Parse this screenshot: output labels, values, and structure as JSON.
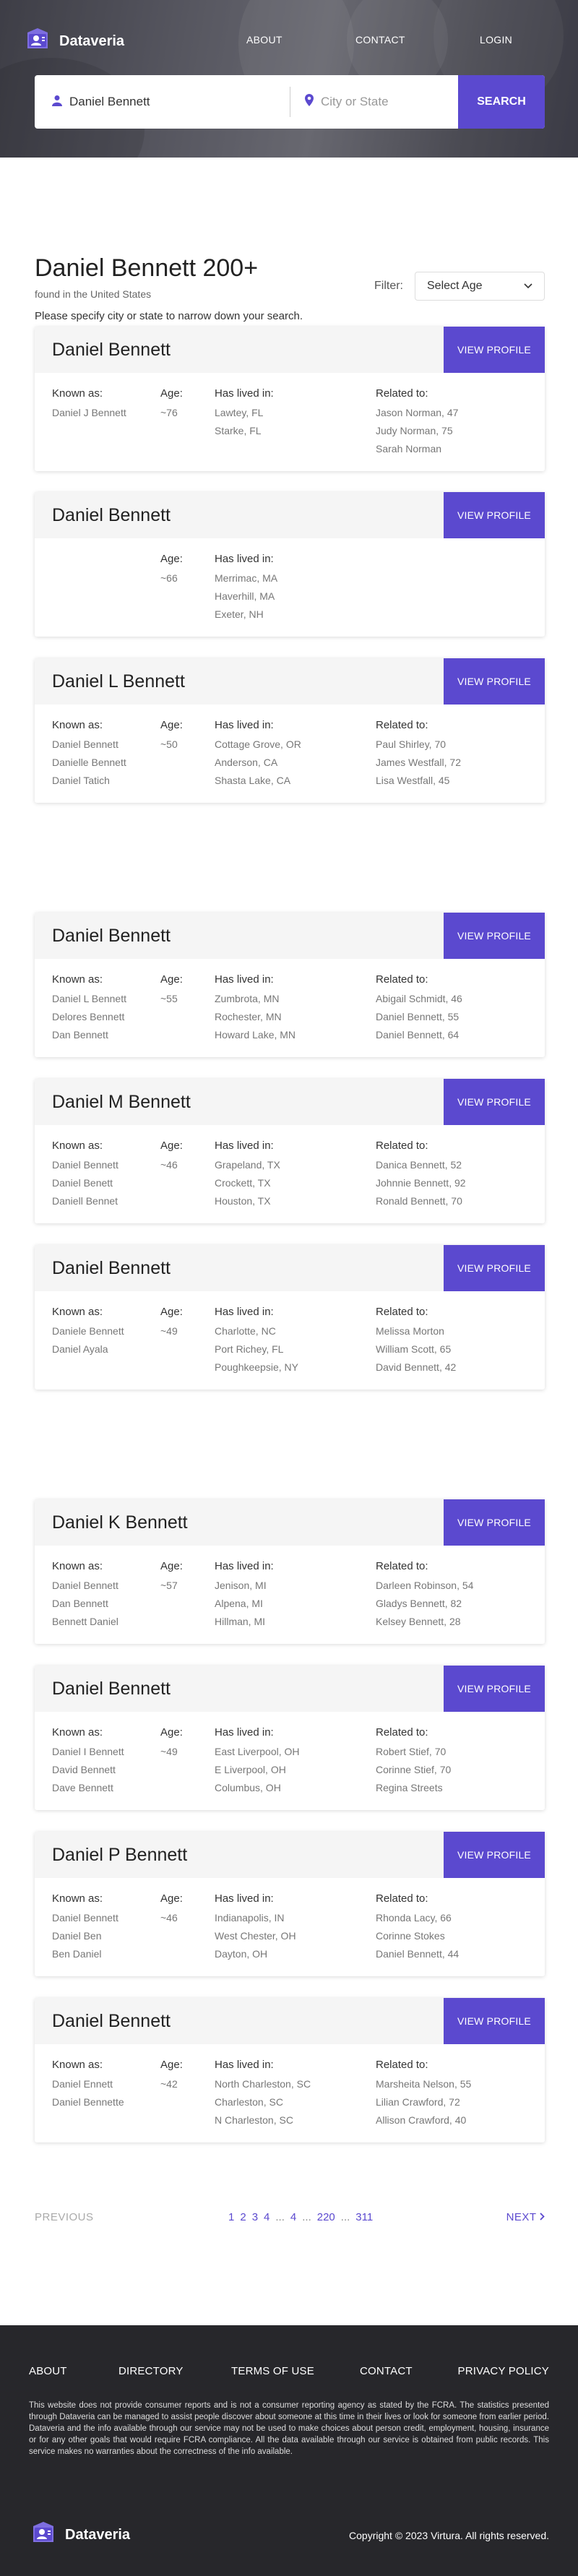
{
  "brand": {
    "name": "Dataveria",
    "accent": "#5b49cf",
    "logo_icon": "person-id-icon"
  },
  "nav": {
    "about": "ABOUT",
    "contact": "CONTACT",
    "login": "LOGIN"
  },
  "search": {
    "name_value": "Daniel Bennett",
    "location_placeholder": "City or State",
    "button_label": "SEARCH"
  },
  "results": {
    "title": "Daniel Bennett 200+",
    "subtitle": "found in the United States",
    "note": "Please specify city or state to narrow down your search.",
    "filter_label": "Filter:",
    "filter_value": "Select Age"
  },
  "labels": {
    "known_as": "Known as:",
    "age": "Age:",
    "lived": "Has lived in:",
    "related": "Related to:",
    "view": "VIEW PROFILE"
  },
  "cards": [
    {
      "name": "Daniel Bennett",
      "known": [
        "Daniel J Bennett"
      ],
      "age": "~76",
      "lived": [
        "Lawtey, FL",
        "Starke, FL"
      ],
      "related": [
        "Jason Norman, 47",
        "Judy Norman, 75",
        "Sarah Norman"
      ]
    },
    {
      "name": "Daniel Bennett",
      "known": [],
      "age": "~66",
      "lived": [
        "Merrimac, MA",
        "Haverhill, MA",
        "Exeter, NH"
      ],
      "related": []
    },
    {
      "name": "Daniel L Bennett",
      "known": [
        "Daniel Bennett",
        "Danielle Bennett",
        "Daniel Tatich"
      ],
      "age": "~50",
      "lived": [
        "Cottage Grove, OR",
        "Anderson, CA",
        "Shasta Lake, CA"
      ],
      "related": [
        "Paul Shirley, 70",
        "James Westfall, 72",
        "Lisa Westfall, 45"
      ]
    },
    {
      "name": "Daniel Bennett",
      "known": [
        "Daniel L Bennett",
        "Delores Bennett",
        "Dan Bennett"
      ],
      "age": "~55",
      "lived": [
        "Zumbrota, MN",
        "Rochester, MN",
        "Howard Lake, MN"
      ],
      "related": [
        "Abigail Schmidt, 46",
        "Daniel Bennett, 55",
        "Daniel Bennett, 64"
      ]
    },
    {
      "name": "Daniel M Bennett",
      "known": [
        "Daniel Bennett",
        "Daniel Benett",
        "Daniell Bennet"
      ],
      "age": "~46",
      "lived": [
        "Grapeland, TX",
        "Crockett, TX",
        "Houston, TX"
      ],
      "related": [
        "Danica Bennett, 52",
        "Johnnie Bennett, 92",
        "Ronald Bennett, 70"
      ]
    },
    {
      "name": "Daniel Bennett",
      "known": [
        "Daniele Bennett",
        "Daniel Ayala"
      ],
      "age": "~49",
      "lived": [
        "Charlotte, NC",
        "Port Richey, FL",
        "Poughkeepsie, NY"
      ],
      "related": [
        "Melissa Morton",
        "William Scott, 65",
        "David Bennett, 42"
      ]
    },
    {
      "name": "Daniel K Bennett",
      "known": [
        "Daniel Bennett",
        "Dan Bennett",
        "Bennett Daniel"
      ],
      "age": "~57",
      "lived": [
        "Jenison, MI",
        "Alpena, MI",
        "Hillman, MI"
      ],
      "related": [
        "Darleen Robinson, 54",
        "Gladys Bennett, 82",
        "Kelsey Bennett, 28"
      ]
    },
    {
      "name": "Daniel Bennett",
      "known": [
        "Daniel I Bennett",
        "David Bennett",
        "Dave Bennett"
      ],
      "age": "~49",
      "lived": [
        "East Liverpool, OH",
        "E Liverpool, OH",
        "Columbus, OH"
      ],
      "related": [
        "Robert Stief, 70",
        "Corinne Stief, 70",
        "Regina Streets"
      ]
    },
    {
      "name": "Daniel P Bennett",
      "known": [
        "Daniel Bennett",
        "Daniel Ben",
        "Ben Daniel"
      ],
      "age": "~46",
      "lived": [
        "Indianapolis, IN",
        "West Chester, OH",
        "Dayton, OH"
      ],
      "related": [
        "Rhonda Lacy, 66",
        "Corinne Stokes",
        "Daniel Bennett, 44"
      ]
    },
    {
      "name": "Daniel Bennett",
      "known": [
        "Daniel Ennett",
        "Daniel Bennette"
      ],
      "age": "~42",
      "lived": [
        "North Charleston, SC",
        "Charleston, SC",
        "N Charleston, SC"
      ],
      "related": [
        "Marsheita Nelson, 55",
        "Lilian Crawford, 72",
        "Allison Crawford, 40"
      ]
    }
  ],
  "pagination": {
    "prev": "PREVIOUS",
    "next": "NEXT",
    "pages": [
      "1",
      "2",
      "3",
      "4",
      "...",
      "4",
      "...",
      "220",
      "...",
      "311"
    ]
  },
  "footer": {
    "links": [
      "ABOUT",
      "DIRECTORY",
      "TERMS OF USE",
      "CONTACT",
      "PRIVACY POLICY"
    ],
    "disclaimer": "This website does not provide consumer reports and is not a consumer reporting agency as stated by the FCRA. The statistics presented through Dataveria can be managed to assist people discover about someone at this time in their lives or look for someone from earlier period. Dataveria and the info available through our service may not be used to make choices about person credit, employment, housing, insurance or for any other goals that would require FCRA compliance. All the data available through our service is obtained from public records. This service makes no warranties about the correctness of the info available.",
    "copyright": "Copyright © 2023 Virtura. All rights reserved."
  }
}
